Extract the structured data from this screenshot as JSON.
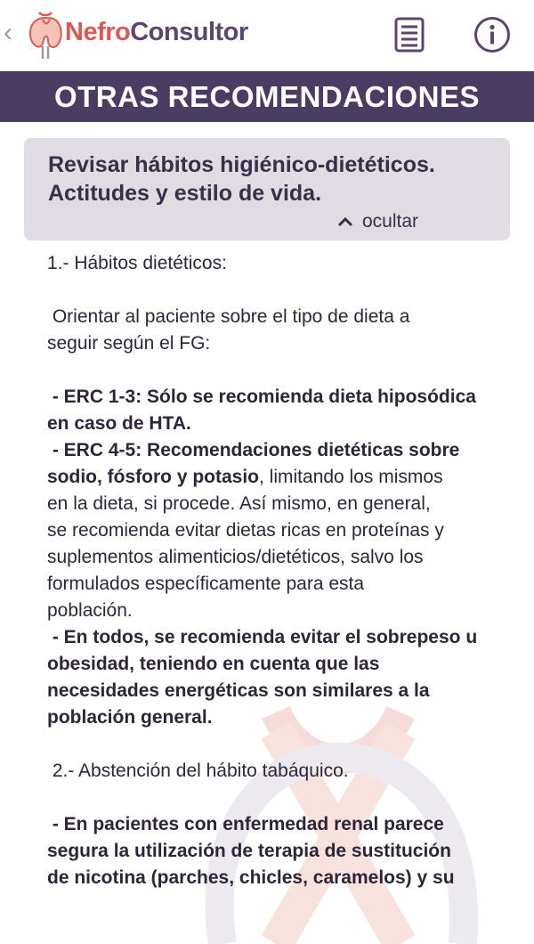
{
  "header": {
    "back_glyph": "‹",
    "brand_part1": "Nefro",
    "brand_part2": "Consultor",
    "doc_icon": "document-list-icon",
    "info_icon": "info-icon"
  },
  "title": "OTRAS RECOMENDACIONES",
  "card": {
    "title_line1": "Revisar hábitos higiénico-dietéticos.",
    "title_line2": "Actitudes y estilo de vida.",
    "toggle_label": "ocultar"
  },
  "content": {
    "s1_heading": "1.- Hábitos dietéticos:",
    "s1_intro_line1": " Orientar al paciente sobre el tipo de dieta a",
    "s1_intro_line2": "seguir según el FG:",
    "erc13_line1": " - ERC 1-3: Sólo se recomienda dieta hiposódica",
    "erc13_line2": "en caso de HTA.",
    "erc45_line1": " - ERC 4-5: Recomendaciones dietéticas sobre",
    "erc45_line2_bold": "sodio, fósforo y potasio",
    "erc45_line2_rest": ", limitando los mismos",
    "erc45_line3": "en la dieta, si procede. Así mismo, en general,",
    "erc45_line4": "se recomienda evitar dietas ricas en proteínas y",
    "erc45_line5": "suplementos alimenticios/dietéticos, salvo los",
    "erc45_line6": "formulados específicamente para esta",
    "erc45_line7": "población.",
    "todos_line1": " - En todos, se recomienda evitar el sobrepeso u",
    "todos_line2": "obesidad, teniendo en cuenta que las",
    "todos_line3": "necesidades energéticas son similares a la",
    "todos_line4": "población general.",
    "s2_heading": " 2.- Abstención del hábito tabáquico.",
    "s2_line1": " - En pacientes con enfermedad renal parece",
    "s2_line2": "segura la utilización de terapia de sustitución",
    "s2_line3": "de nicotina (parches, chicles, caramelos) y su"
  },
  "colors": {
    "title_bar": "#4b3c63",
    "card_bg": "#e1dce4",
    "brand_red": "#d95a55",
    "brand_purple": "#5a4670"
  }
}
